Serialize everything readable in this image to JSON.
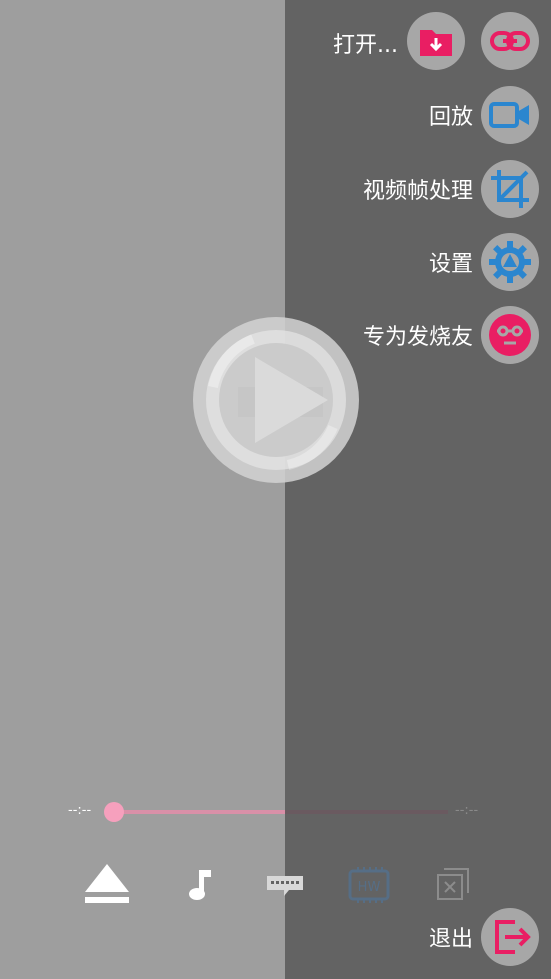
{
  "menu": {
    "open_label": "打开...",
    "playback_label": "回放",
    "frame_label": "视频帧处理",
    "settings_label": "设置",
    "enthusiast_label": "专为发烧友",
    "exit_label": "退出"
  },
  "icons": {
    "open": "folder-download-icon",
    "link": "link-icon",
    "playback": "video-camera-icon",
    "frame": "crop-icon",
    "settings": "gear-icon",
    "enthusiast": "face-icon",
    "exit": "exit-icon",
    "center": "play-logo-icon",
    "eject": "eject-icon",
    "audio": "music-note-icon",
    "subtitle": "subtitle-icon",
    "hw": "hw-decoder-icon",
    "close_window": "close-window-icon"
  },
  "playback": {
    "time_elapsed": "--:--",
    "time_total": "--:--",
    "hw_label": "HW",
    "progress": 0
  },
  "colors": {
    "accent_pink": "#e91e63",
    "accent_blue": "#2b86cf",
    "panel_dark": "#636363",
    "panel_light": "#9e9e9e"
  }
}
